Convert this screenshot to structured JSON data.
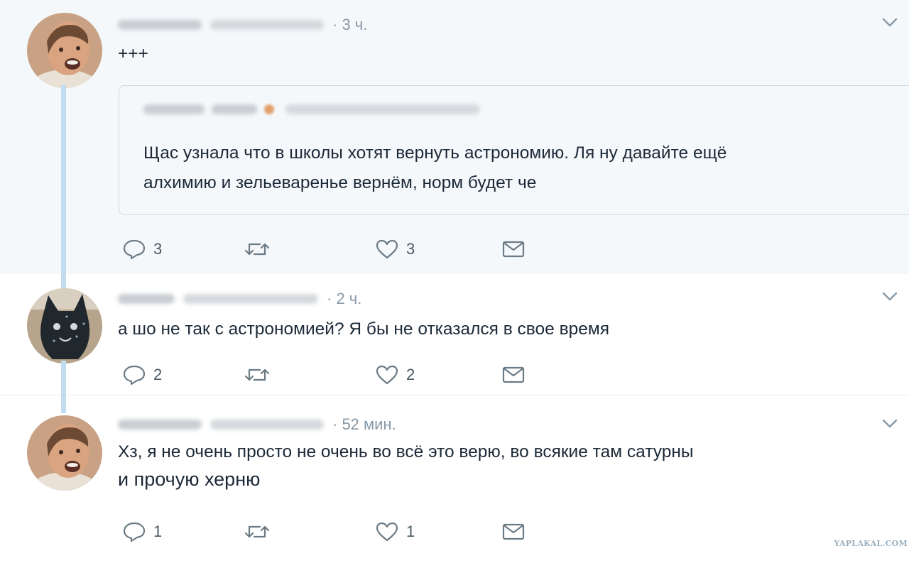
{
  "tweets": [
    {
      "time": "· 3 ч.",
      "text": "+++",
      "quote": {
        "lines": [
          "Щас узнала что в школы хотят вернуть астрономию. Ля ну давайте ещё",
          "алхимию и зельеваренье вернём, норм будет че"
        ]
      },
      "actions": {
        "replies": "3",
        "retweets": "",
        "likes": "3"
      }
    },
    {
      "time": "· 2 ч.",
      "text": "а шо не так  с астрономией? Я бы не отказался в свое время",
      "actions": {
        "replies": "2",
        "retweets": "",
        "likes": "2"
      }
    },
    {
      "time": "· 52 мин.",
      "text_lines": [
        "Хз, я не очень просто не очень во всё это верю, во всякие там сатурны",
        "и прочую херню"
      ],
      "actions": {
        "replies": "1",
        "retweets": "",
        "likes": "1"
      }
    }
  ],
  "icons": {
    "reply": "reply-icon",
    "retweet": "retweet-icon",
    "like": "heart-icon",
    "dm": "envelope-icon",
    "more": "chevron-down-icon"
  },
  "colors": {
    "highlight_bg": "#f5f8fa",
    "thread_line": "#c2dcef",
    "icon_gray": "#6b7b86"
  },
  "watermark": "YAPLAKAL.COM"
}
